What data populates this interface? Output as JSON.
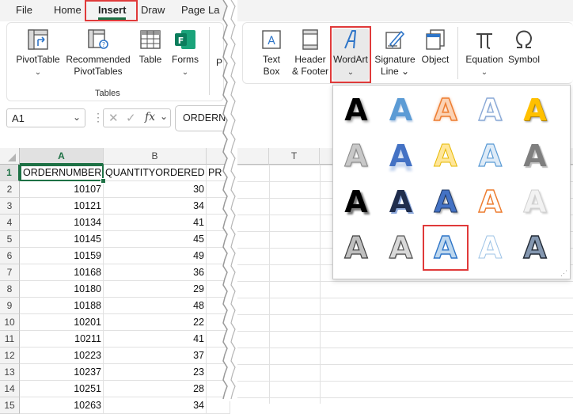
{
  "menu": {
    "tabs": [
      "File",
      "Home",
      "Insert",
      "Draw",
      "Page La"
    ],
    "active_tab": "Insert"
  },
  "ribbon": {
    "tables_group": {
      "label": "Tables",
      "buttons": [
        {
          "line1": "PivotTable",
          "line2": "",
          "chevron": "⌄"
        },
        {
          "line1": "Recommended",
          "line2": "PivotTables",
          "chevron": ""
        },
        {
          "line1": "Table",
          "line2": "",
          "chevron": ""
        },
        {
          "line1": "Forms",
          "line2": "",
          "chevron": "⌄"
        }
      ]
    },
    "text_group": {
      "buttons": [
        {
          "line1": "Text",
          "line2": "Box"
        },
        {
          "line1": "Header",
          "line2": "& Footer"
        },
        {
          "line1": "WordArt",
          "line2": "⌄"
        },
        {
          "line1": "Signature",
          "line2": "Line ⌄"
        },
        {
          "line1": "Object",
          "line2": ""
        }
      ]
    },
    "symbols_group": {
      "buttons": [
        {
          "line1": "Equation",
          "line2": "⌄"
        },
        {
          "line1": "Symbol",
          "line2": ""
        }
      ]
    },
    "truncated_label": "P"
  },
  "formula_bar": {
    "name_box": "A1",
    "fx_label": "fx",
    "content": "ORDERN"
  },
  "sheet": {
    "col_headers": [
      "A",
      "B",
      "T"
    ],
    "row_numbers": [
      "1",
      "2",
      "3",
      "4",
      "5",
      "6",
      "7",
      "8",
      "9",
      "10",
      "11",
      "12",
      "13",
      "14",
      "15"
    ],
    "header_row": [
      "ORDERNUMBER",
      "QUANTITYORDERED",
      "PR"
    ],
    "order_numbers": [
      "10107",
      "10121",
      "10134",
      "10145",
      "10159",
      "10168",
      "10180",
      "10188",
      "10201",
      "10211",
      "10223",
      "10237",
      "10251",
      "10263"
    ],
    "quantities": [
      "30",
      "34",
      "41",
      "45",
      "49",
      "36",
      "29",
      "48",
      "22",
      "41",
      "37",
      "23",
      "28",
      "34"
    ]
  },
  "wordart": {
    "glyph": "A",
    "selected_index": 17,
    "rows": 4,
    "cols": 5
  },
  "colors": {
    "accent_red": "#e03a3a",
    "excel_green": "#1e7145",
    "wordart_blue": "#2e75c8",
    "wordart_orange": "#ed7d31",
    "wordart_gold": "#ffc000"
  }
}
